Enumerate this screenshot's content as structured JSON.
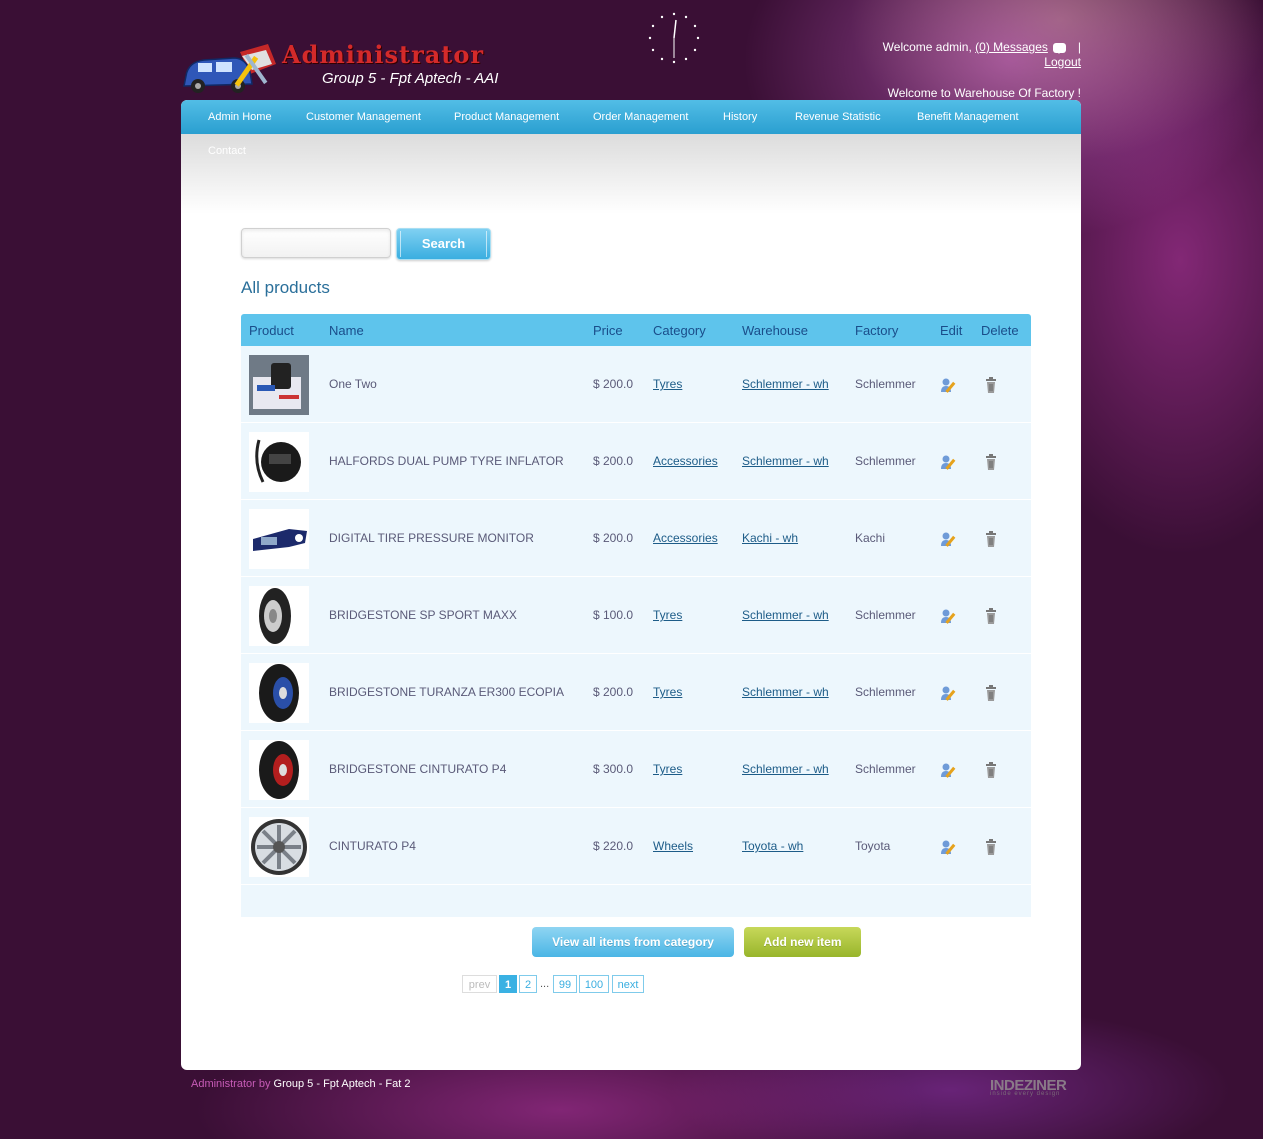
{
  "header": {
    "logo_title": "Administrator",
    "logo_subtitle": "Group 5 - Fpt Aptech - AAI",
    "welcome_user": "Welcome admin,",
    "messages_link": "(0) Messages",
    "separator": "|",
    "logout_link": "Logout",
    "welcome_warehouse": "Welcome to Warehouse Of Factory !"
  },
  "nav": {
    "items": [
      {
        "label": "Admin Home"
      },
      {
        "label": "Customer Management"
      },
      {
        "label": "Product Management"
      },
      {
        "label": "Order Management"
      },
      {
        "label": "History"
      },
      {
        "label": "Revenue Statistic"
      },
      {
        "label": "Benefit Management"
      }
    ],
    "contact": "Contact"
  },
  "search": {
    "value": "",
    "placeholder": "",
    "button_label": "Search"
  },
  "section_title": "All products",
  "table": {
    "columns": [
      "Product",
      "Name",
      "Price",
      "Category",
      "Warehouse",
      "Factory",
      "Edit",
      "Delete"
    ],
    "rows": [
      {
        "thumb": "box-icon",
        "name": "One Two",
        "price": "$ 200.0",
        "category": "Tyres",
        "warehouse": "Schlemmer - wh",
        "factory": "Schlemmer"
      },
      {
        "thumb": "pump-icon",
        "name": "HALFORDS DUAL PUMP TYRE INFLATOR",
        "price": "$ 200.0",
        "category": "Accessories",
        "warehouse": "Schlemmer - wh",
        "factory": "Schlemmer"
      },
      {
        "thumb": "gauge-icon",
        "name": "DIGITAL TIRE PRESSURE MONITOR",
        "price": "$ 200.0",
        "category": "Accessories",
        "warehouse": "Kachi - wh",
        "factory": "Kachi"
      },
      {
        "thumb": "tire-icon",
        "name": "BRIDGESTONE SP SPORT MAXX",
        "price": "$ 100.0",
        "category": "Tyres",
        "warehouse": "Schlemmer - wh",
        "factory": "Schlemmer"
      },
      {
        "thumb": "tire-blue-icon",
        "name": "BRIDGESTONE TURANZA ER300 ECOPIA",
        "price": "$ 200.0",
        "category": "Tyres",
        "warehouse": "Schlemmer - wh",
        "factory": "Schlemmer"
      },
      {
        "thumb": "tire-red-icon",
        "name": "BRIDGESTONE CINTURATO P4",
        "price": "$ 300.0",
        "category": "Tyres",
        "warehouse": "Schlemmer - wh",
        "factory": "Schlemmer"
      },
      {
        "thumb": "wheel-icon",
        "name": "CINTURATO P4",
        "price": "$ 220.0",
        "category": "Wheels",
        "warehouse": "Toyota - wh",
        "factory": "Toyota"
      }
    ]
  },
  "actions": {
    "view_all_label": "View all items from category",
    "add_new_label": "Add new item"
  },
  "pagination": {
    "prev": "prev",
    "pages": [
      "1",
      "2"
    ],
    "ellipsis": "...",
    "last_pages": [
      "99",
      "100"
    ],
    "next": "next",
    "current": "1"
  },
  "footer": {
    "prefix": "Administrator by",
    "credit": "Group 5 - Fpt Aptech - Fat 2",
    "brand": "INDEZINER",
    "brand_tagline": "inside every design"
  },
  "colors": {
    "nav_blue": "#2a9fd0",
    "header_text": "#1a4d8a",
    "accent_green": "#98b52b",
    "background": "#3a0f35"
  }
}
